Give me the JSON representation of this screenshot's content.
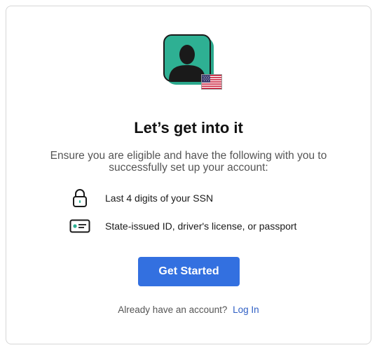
{
  "header": {
    "avatar_icon": "person-silhouette-icon",
    "flag_icon": "us-flag-icon",
    "title": "Let’s get into it",
    "subtitle": "Ensure you are eligible and have the following with you to successfully set up your account:"
  },
  "requirements": [
    {
      "icon": "lock-icon",
      "label": "Last 4 digits of your SSN"
    },
    {
      "icon": "id-card-icon",
      "label": "State-issued ID, driver's license, or passport"
    }
  ],
  "actions": {
    "get_started_label": "Get Started",
    "signin_prompt": "Already have an account?",
    "signin_link": "Log In"
  },
  "colors": {
    "accent": "#3370e0",
    "avatar_bg": "#2eb093",
    "link": "#2f5fc4"
  }
}
